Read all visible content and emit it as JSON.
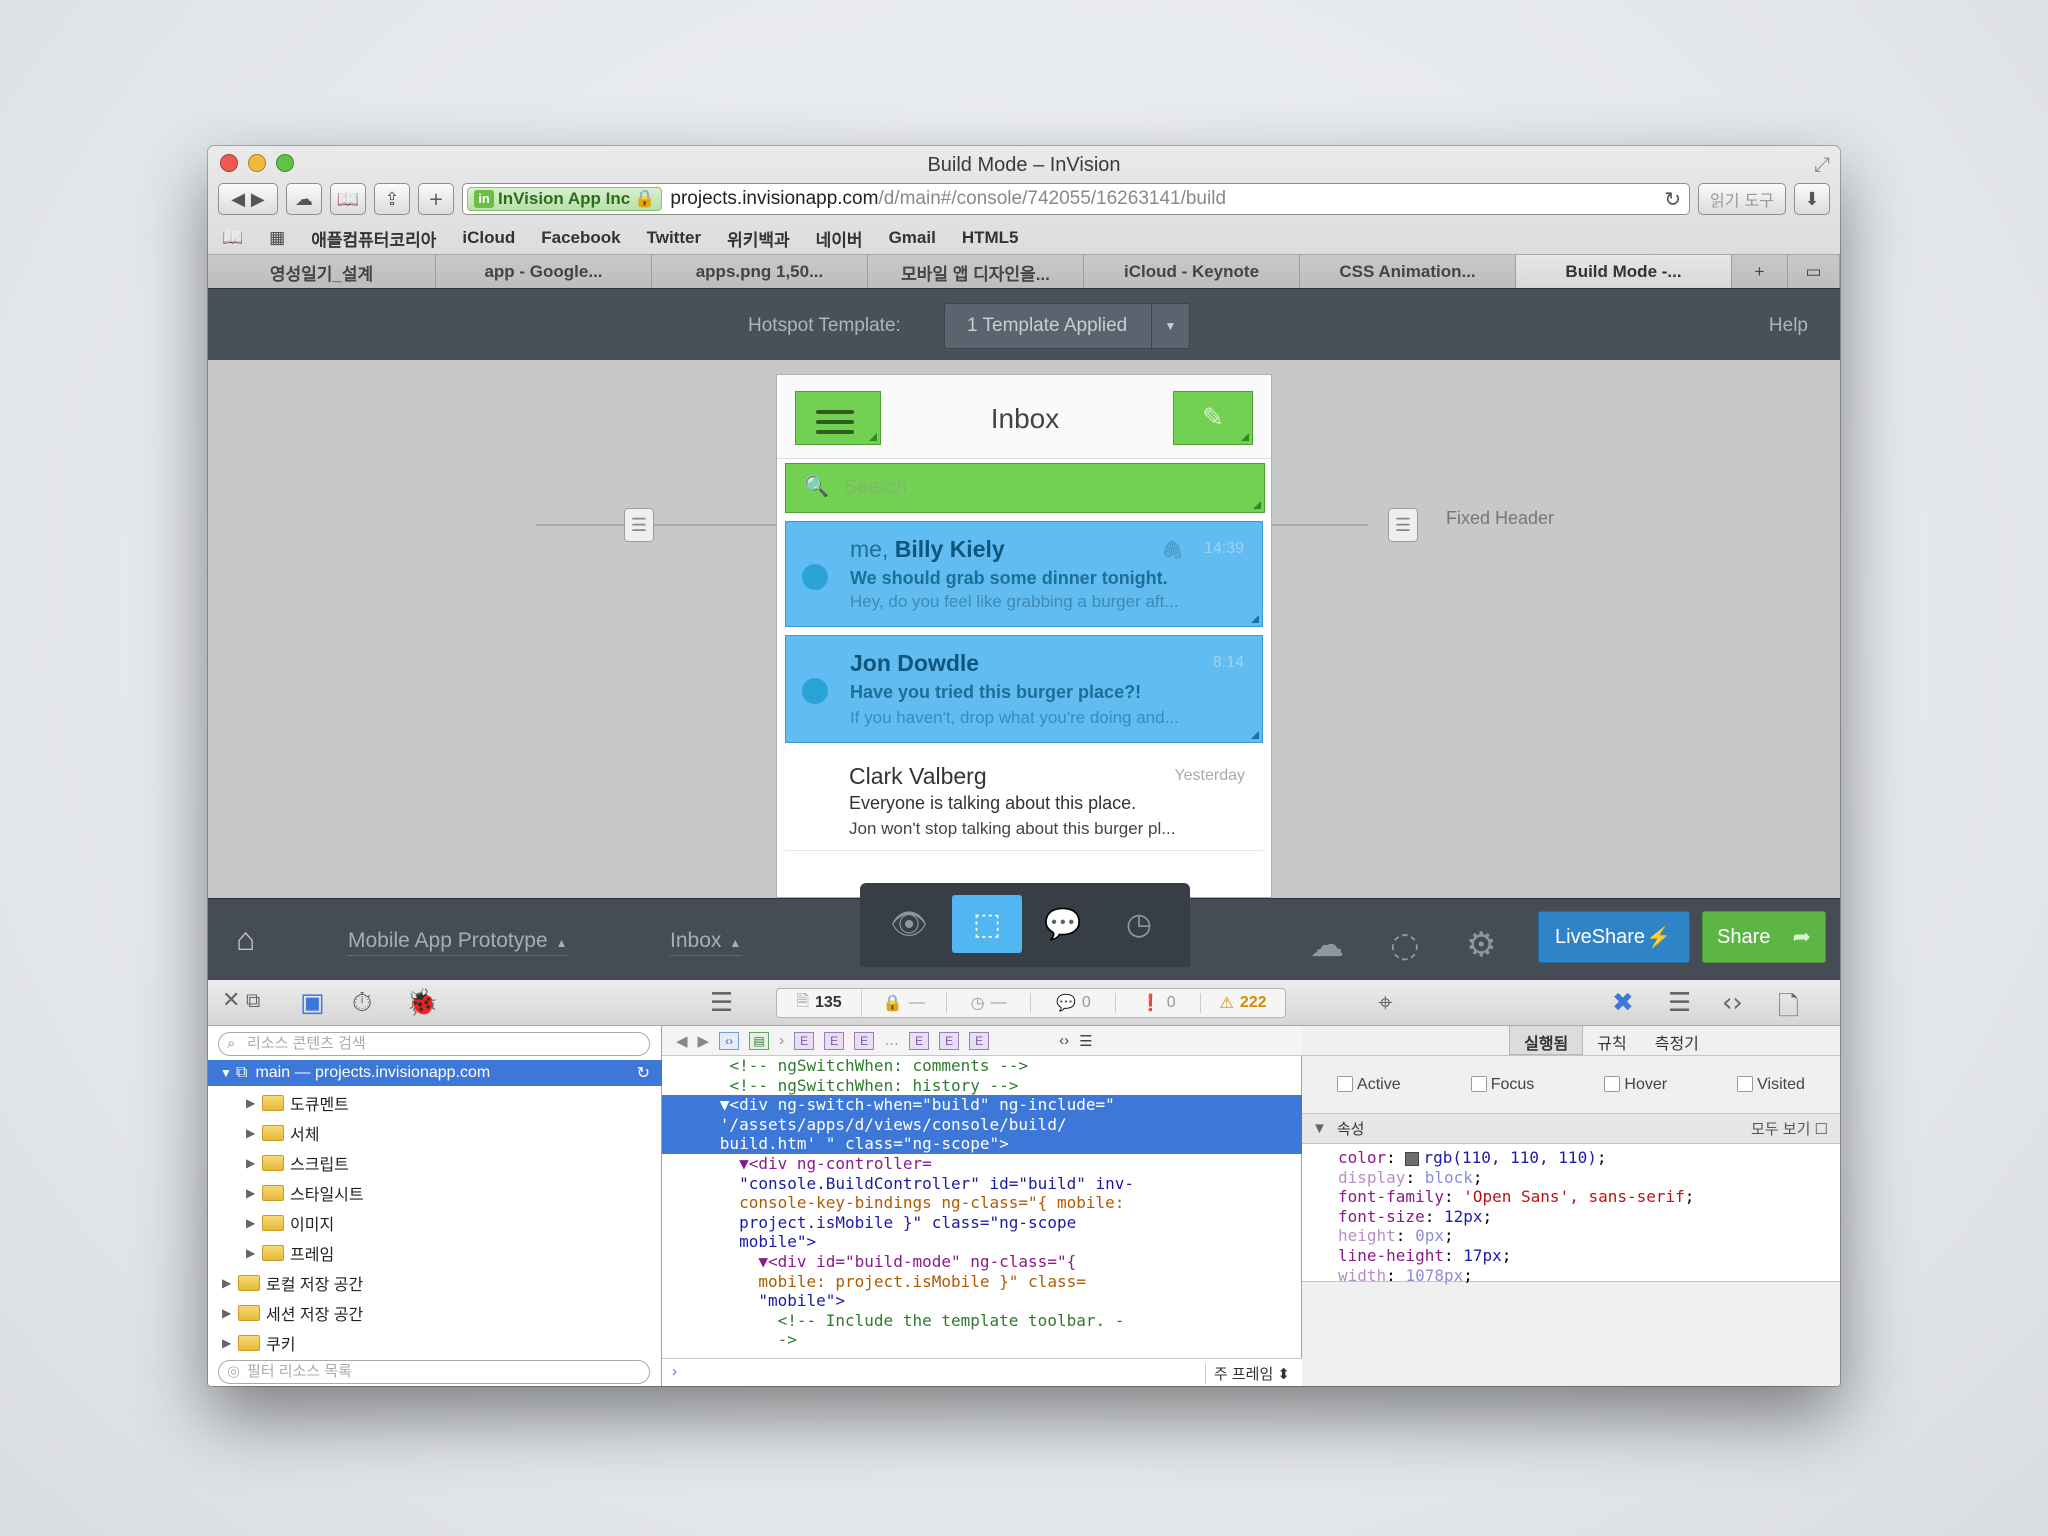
{
  "window": {
    "title": "Build Mode – InVision"
  },
  "browser": {
    "site_badge": "InVision App Inc",
    "url_host": "projects.invisionapp.com",
    "url_path": "/d/main#/console/742055/16263141/build",
    "reader_label": "읽기 도구",
    "bookmarks": [
      "애플컴퓨터코리아",
      "iCloud",
      "Facebook",
      "Twitter",
      "위키백과",
      "네이버",
      "Gmail",
      "HTML5"
    ],
    "tabs": [
      "영성일기_설계",
      "app - Google...",
      "apps.png 1,50...",
      "모바일 앱 디자인을...",
      "iCloud - Keynote",
      "CSS Animation...",
      "Build Mode -..."
    ],
    "tab_plus": "+"
  },
  "hotspot": {
    "label": "Hotspot Template:",
    "selected": "1 Template Applied",
    "help": "Help"
  },
  "canvas": {
    "fixed_header_label": "Fixed Header"
  },
  "phone": {
    "title": "Inbox",
    "search_placeholder": "Search",
    "messages": [
      {
        "from_prefix": "me,",
        "from_name": "Billy Kiely",
        "time": "14:39",
        "subject": "We should grab some dinner tonight.",
        "preview": "Hey, do you feel like grabbing a burger aft..."
      },
      {
        "from_prefix": "",
        "from_name": "Jon Dowdle",
        "time": "8:14",
        "subject": "Have you tried this burger place?!",
        "preview": "If you haven't, drop what you're doing and..."
      },
      {
        "from_prefix": "",
        "from_name": "Clark Valberg",
        "time": "Yesterday",
        "subject": "Everyone is talking about this place.",
        "preview": "Jon won't stop talking about this burger pl..."
      }
    ]
  },
  "bottombar": {
    "project": "Mobile App Prototype",
    "screen": "Inbox",
    "liveshare": "LiveShare",
    "share": "Share"
  },
  "devtools": {
    "counts": {
      "resources": "135",
      "lock": "—",
      "time": "—",
      "comments": "0",
      "errors": "0",
      "warnings": "222"
    },
    "search_placeholder": "리소스 콘텐츠 검색",
    "filter_placeholder": "필터 리소스 목록",
    "tree": [
      {
        "label": "main — projects.invisionapp.com"
      },
      {
        "label": "도큐멘트"
      },
      {
        "label": "서체"
      },
      {
        "label": "스크립트"
      },
      {
        "label": "스타일시트"
      },
      {
        "label": "이미지"
      },
      {
        "label": "프레임"
      },
      {
        "label": "로컬 저장 공간"
      },
      {
        "label": "세션 저장 공간"
      },
      {
        "label": "쿠키"
      }
    ],
    "frame_label": "주 프레임",
    "right_tabs": [
      "실행됨",
      "규칙",
      "측정기"
    ],
    "states": [
      "Active",
      "Focus",
      "Hover",
      "Visited"
    ],
    "props_header": "속성",
    "show_all": "모두 보기",
    "properties": [
      {
        "name": "color",
        "value": "rgb(110, 110, 110)"
      },
      {
        "name": "display",
        "value": "block"
      },
      {
        "name": "font-family",
        "value": "'Open Sans', sans-serif"
      },
      {
        "name": "font-size",
        "value": "12px"
      },
      {
        "name": "height",
        "value": "0px"
      },
      {
        "name": "line-height",
        "value": "17px"
      },
      {
        "name": "width",
        "value": "1078px"
      }
    ],
    "code": {
      "l1": "<!-- ngSwitchWhen: comments -->",
      "l2": "<!-- ngSwitchWhen: history -->",
      "l3": "▼<div ng-switch-when=\"build\" ng-include=\"",
      "l4": "'/assets/apps/d/views/console/build/",
      "l5": "build.htm' \" class=\"ng-scope\">",
      "l6": "▼<div ng-controller=",
      "l7": "\"console.BuildController\" id=\"build\" inv-",
      "l8": "console-key-bindings ng-class=\"{ mobile:",
      "l9": "project.isMobile }\" class=\"ng-scope",
      "l10": "mobile\">",
      "l11": "▼<div id=\"build-mode\" ng-class=\"{",
      "l12": "mobile: project.isMobile }\" class=",
      "l13": "\"mobile\">",
      "l14": "<!-- Include the template toolbar. -",
      "l15": "->"
    }
  },
  "colors": {
    "accent_green": "#66cc44",
    "accent_blue": "#52b6f0",
    "liveshare_blue": "#2f83c7",
    "share_green": "#5db546",
    "selection_blue": "#3d78d8"
  }
}
